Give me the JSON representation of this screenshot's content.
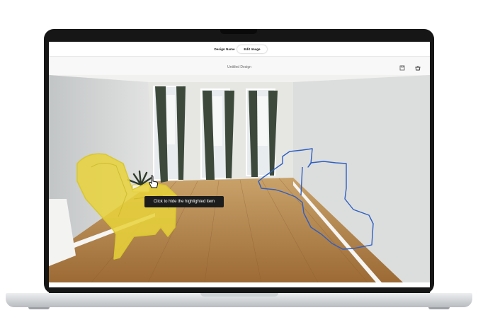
{
  "toolbar": {
    "tabs": [
      {
        "label": "Design Name"
      },
      {
        "label": "Edit Image"
      }
    ]
  },
  "design": {
    "title": "Untitled Design"
  },
  "actions": {
    "save_icon": "save-icon",
    "cart_icon": "cart-icon"
  },
  "canvas": {
    "tooltip": "Click to hide the highlighted item",
    "highlight_color": "#e8d23a",
    "outline_color": "#2f5fc2"
  }
}
